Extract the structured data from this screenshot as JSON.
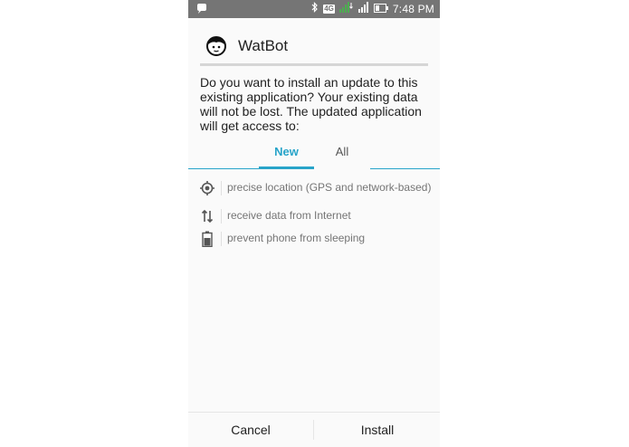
{
  "status_bar": {
    "network_type": "4G",
    "time": "7:48 PM"
  },
  "app": {
    "name": "WatBot",
    "icon": "robot-face-icon"
  },
  "message": "Do you want to install an update to this existing application? Your existing data will not be lost. The updated application will get access to:",
  "tabs": [
    {
      "label": "New",
      "selected": true
    },
    {
      "label": "All",
      "selected": false
    }
  ],
  "permissions": [
    {
      "icon": "location-icon",
      "label": "precise location (GPS and network-based)"
    },
    {
      "icon": "data-transfer-icon",
      "label": "receive data from Internet"
    },
    {
      "icon": "battery-icon",
      "label": "prevent phone from sleeping"
    }
  ],
  "buttons": {
    "cancel": "Cancel",
    "install": "Install"
  },
  "colors": {
    "accent": "#28a4c9",
    "status_bar": "#757575",
    "signal_green": "#4caf50"
  }
}
